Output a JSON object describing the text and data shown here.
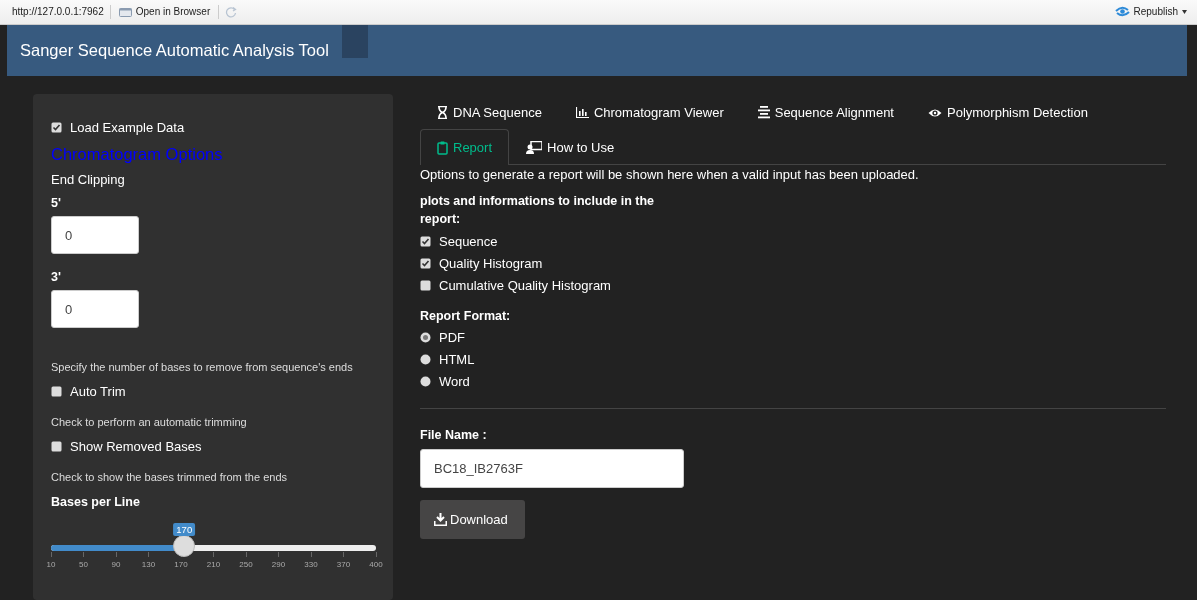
{
  "toolbar": {
    "url": "http://127.0.0.1:7962",
    "open_button": "Open in Browser",
    "republish_button": "Republish"
  },
  "navbar": {
    "title": "Sanger Sequence Automatic Analysis Tool"
  },
  "sidebar": {
    "load_example": {
      "label": "Load Example Data",
      "checked": true
    },
    "section_title": "Chromatogram Options",
    "end_clipping_label": "End Clipping",
    "inputs": [
      {
        "label": "5'",
        "value": "0"
      },
      {
        "label": "3'",
        "value": "0"
      }
    ],
    "clip_help": "Specify the number of bases to remove from sequence's ends",
    "options": [
      {
        "label": "Auto Trim",
        "checked": false,
        "help": "Check to perform an automatic trimming"
      },
      {
        "label": "Show Removed Bases",
        "checked": false,
        "help": "Check to show the bases trimmed from the ends"
      }
    ],
    "slider": {
      "label": "Bases per Line",
      "value": "170",
      "level": 0.41,
      "ticks": [
        "10",
        "50",
        "90",
        "130",
        "170",
        "210",
        "250",
        "290",
        "330",
        "370",
        "400"
      ]
    }
  },
  "tabs": [
    {
      "label": "DNA Sequence",
      "selected": false
    },
    {
      "label": "Chromatogram Viewer",
      "selected": false
    },
    {
      "label": "Sequence Alignment",
      "selected": false
    },
    {
      "label": "Polymorphism Detection",
      "selected": false
    },
    {
      "label": "Report",
      "selected": true
    },
    {
      "label": "How to Use",
      "selected": false
    }
  ],
  "report": {
    "message": "Options to generate a report will be shown here when a valid input has been uploaded.",
    "include_label": "plots and informations to include in the report:",
    "include": [
      {
        "label": "Sequence",
        "checked": true
      },
      {
        "label": "Quality Histogram",
        "checked": true
      },
      {
        "label": "Cumulative Quality Histogram",
        "checked": false
      }
    ],
    "format_label": "Report Format:",
    "formats": [
      {
        "label": "PDF",
        "selected": true
      },
      {
        "label": "HTML",
        "selected": false
      },
      {
        "label": "Word",
        "selected": false
      }
    ],
    "file_name_label": "File Name :",
    "file_name": "BC18_IB2763F",
    "download_button": "Download"
  }
}
